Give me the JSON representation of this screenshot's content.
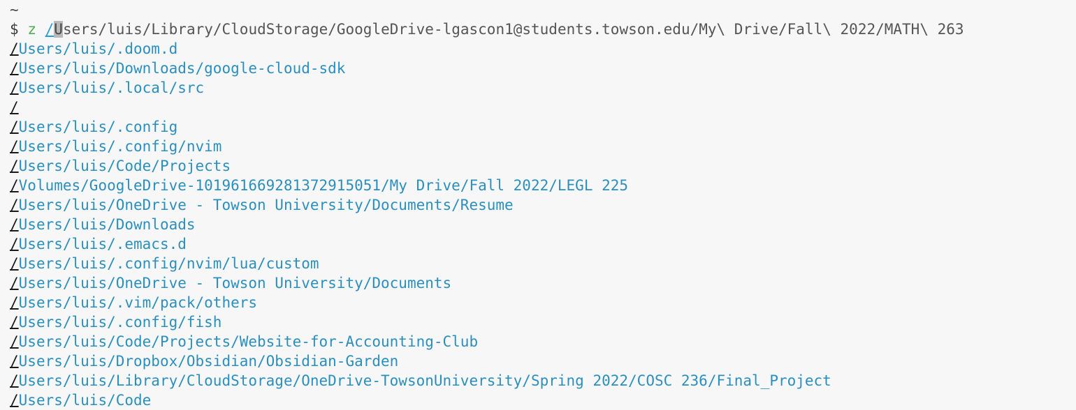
{
  "terminal": {
    "home_indicator": "~",
    "prompt": {
      "symbol": "$",
      "command": "z",
      "arg_first_char": "/",
      "arg_cursor_char": "U",
      "arg_rest": "sers/luis/Library/CloudStorage/GoogleDrive-lgascon1@students.towson.edu/My\\ Drive/Fall\\ 2022/MATH\\ 263"
    },
    "suggestions": [
      {
        "slash": "/",
        "rest": "Users/luis/.doom.d"
      },
      {
        "slash": "/",
        "rest": "Users/luis/Downloads/google-cloud-sdk"
      },
      {
        "slash": "/",
        "rest": "Users/luis/.local/src"
      },
      {
        "slash": "/",
        "rest": ""
      },
      {
        "slash": "/",
        "rest": "Users/luis/.config"
      },
      {
        "slash": "/",
        "rest": "Users/luis/.config/nvim"
      },
      {
        "slash": "/",
        "rest": "Users/luis/Code/Projects"
      },
      {
        "slash": "/",
        "rest": "Volumes/GoogleDrive-101961669281372915051/My Drive/Fall 2022/LEGL 225"
      },
      {
        "slash": "/",
        "rest": "Users/luis/OneDrive - Towson University/Documents/Resume"
      },
      {
        "slash": "/",
        "rest": "Users/luis/Downloads"
      },
      {
        "slash": "/",
        "rest": "Users/luis/.emacs.d"
      },
      {
        "slash": "/",
        "rest": "Users/luis/.config/nvim/lua/custom"
      },
      {
        "slash": "/",
        "rest": "Users/luis/OneDrive - Towson University/Documents"
      },
      {
        "slash": "/",
        "rest": "Users/luis/.vim/pack/others"
      },
      {
        "slash": "/",
        "rest": "Users/luis/.config/fish"
      },
      {
        "slash": "/",
        "rest": "Users/luis/Code/Projects/Website-for-Accounting-Club"
      },
      {
        "slash": "/",
        "rest": "Users/luis/Dropbox/Obsidian/Obsidian-Garden"
      },
      {
        "slash": "/",
        "rest": "Users/luis/Library/CloudStorage/OneDrive-TowsonUniversity/Spring 2022/COSC 236/Final_Project"
      },
      {
        "slash": "/",
        "rest": "Users/luis/Code"
      }
    ]
  },
  "colors": {
    "background": "#f7f7f7",
    "command": "#4caf50",
    "suggestion_path": "#2b8fbe",
    "arg_slash": "#2a9ed8"
  }
}
